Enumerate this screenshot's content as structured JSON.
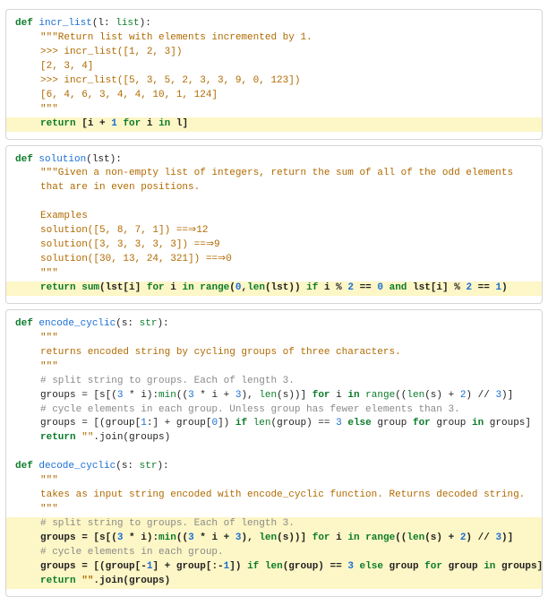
{
  "panels": [
    {
      "lines": [
        {
          "hl": false,
          "indent": 0,
          "tokens": [
            {
              "t": "def ",
              "c": "kw"
            },
            {
              "t": "incr_list",
              "c": "fn"
            },
            {
              "t": "(l: ",
              "c": "plain"
            },
            {
              "t": "list",
              "c": "ty"
            },
            {
              "t": "):",
              "c": "plain"
            }
          ]
        },
        {
          "hl": false,
          "indent": 1,
          "tokens": [
            {
              "t": "\"\"\"Return list with elements incremented by 1.",
              "c": "str"
            }
          ]
        },
        {
          "hl": false,
          "indent": 1,
          "tokens": [
            {
              "t": ">>> incr_list([1, 2, 3])",
              "c": "str"
            }
          ]
        },
        {
          "hl": false,
          "indent": 1,
          "tokens": [
            {
              "t": "[2, 3, 4]",
              "c": "str"
            }
          ]
        },
        {
          "hl": false,
          "indent": 1,
          "tokens": [
            {
              "t": ">>> incr_list([5, 3, 5, 2, 3, 3, 9, 0, 123])",
              "c": "str"
            }
          ]
        },
        {
          "hl": false,
          "indent": 1,
          "tokens": [
            {
              "t": "[6, 4, 6, 3, 4, 4, 10, 1, 124]",
              "c": "str"
            }
          ]
        },
        {
          "hl": false,
          "indent": 1,
          "tokens": [
            {
              "t": "\"\"\"",
              "c": "str"
            }
          ]
        },
        {
          "hl": true,
          "indent": 1,
          "tokens": [
            {
              "t": "return ",
              "c": "kw bold"
            },
            {
              "t": "[i + ",
              "c": "plain bold"
            },
            {
              "t": "1",
              "c": "num bold"
            },
            {
              "t": " ",
              "c": "plain"
            },
            {
              "t": "for",
              "c": "kw bold"
            },
            {
              "t": " i ",
              "c": "plain bold"
            },
            {
              "t": "in",
              "c": "kw bold"
            },
            {
              "t": " l]",
              "c": "plain bold"
            }
          ]
        }
      ]
    },
    {
      "lines": [
        {
          "hl": false,
          "indent": 0,
          "tokens": [
            {
              "t": "def ",
              "c": "kw"
            },
            {
              "t": "solution",
              "c": "fn"
            },
            {
              "t": "(lst):",
              "c": "plain"
            }
          ]
        },
        {
          "hl": false,
          "indent": 1,
          "tokens": [
            {
              "t": "\"\"\"Given a non-empty list of integers, return the sum of all of the odd elements",
              "c": "str"
            }
          ]
        },
        {
          "hl": false,
          "indent": 1,
          "tokens": [
            {
              "t": "that are in even positions.",
              "c": "str"
            }
          ]
        },
        {
          "hl": false,
          "indent": 1,
          "tokens": [
            {
              "t": "",
              "c": "plain"
            }
          ]
        },
        {
          "hl": false,
          "indent": 1,
          "tokens": [
            {
              "t": "Examples",
              "c": "str"
            }
          ]
        },
        {
          "hl": false,
          "indent": 1,
          "tokens": [
            {
              "t": "solution([5, 8, 7, 1]) ==⇒12",
              "c": "str"
            }
          ]
        },
        {
          "hl": false,
          "indent": 1,
          "tokens": [
            {
              "t": "solution([3, 3, 3, 3, 3]) ==⇒9",
              "c": "str"
            }
          ]
        },
        {
          "hl": false,
          "indent": 1,
          "tokens": [
            {
              "t": "solution([30, 13, 24, 321]) ==⇒0",
              "c": "str"
            }
          ]
        },
        {
          "hl": false,
          "indent": 1,
          "tokens": [
            {
              "t": "\"\"\"",
              "c": "str"
            }
          ]
        },
        {
          "hl": true,
          "indent": 1,
          "tokens": [
            {
              "t": "return ",
              "c": "kw bold"
            },
            {
              "t": "sum",
              "c": "bi bold"
            },
            {
              "t": "(lst[i] ",
              "c": "plain bold"
            },
            {
              "t": "for",
              "c": "kw bold"
            },
            {
              "t": " i ",
              "c": "plain bold"
            },
            {
              "t": "in ",
              "c": "kw bold"
            },
            {
              "t": "range",
              "c": "bi bold"
            },
            {
              "t": "(",
              "c": "plain bold"
            },
            {
              "t": "0",
              "c": "num bold"
            },
            {
              "t": ",",
              "c": "plain bold"
            },
            {
              "t": "len",
              "c": "bi bold"
            },
            {
              "t": "(lst)) ",
              "c": "plain bold"
            },
            {
              "t": "if",
              "c": "kw bold"
            },
            {
              "t": " i % ",
              "c": "plain bold"
            },
            {
              "t": "2",
              "c": "num bold"
            },
            {
              "t": " == ",
              "c": "plain bold"
            },
            {
              "t": "0",
              "c": "num bold"
            },
            {
              "t": " ",
              "c": "plain"
            },
            {
              "t": "and",
              "c": "kw bold"
            },
            {
              "t": " lst[i] % ",
              "c": "plain bold"
            },
            {
              "t": "2",
              "c": "num bold"
            },
            {
              "t": " == ",
              "c": "plain bold"
            },
            {
              "t": "1",
              "c": "num bold"
            },
            {
              "t": ")",
              "c": "plain bold"
            }
          ]
        }
      ]
    },
    {
      "lines": [
        {
          "hl": false,
          "indent": 0,
          "tokens": [
            {
              "t": "def ",
              "c": "kw"
            },
            {
              "t": "encode_cyclic",
              "c": "fn"
            },
            {
              "t": "(s: ",
              "c": "plain"
            },
            {
              "t": "str",
              "c": "ty"
            },
            {
              "t": "):",
              "c": "plain"
            }
          ]
        },
        {
          "hl": false,
          "indent": 1,
          "tokens": [
            {
              "t": "\"\"\"",
              "c": "str"
            }
          ]
        },
        {
          "hl": false,
          "indent": 1,
          "tokens": [
            {
              "t": "returns encoded string by cycling groups of three characters.",
              "c": "str"
            }
          ]
        },
        {
          "hl": false,
          "indent": 1,
          "tokens": [
            {
              "t": "\"\"\"",
              "c": "str"
            }
          ]
        },
        {
          "hl": false,
          "indent": 1,
          "tokens": [
            {
              "t": "# split string to groups. Each of length 3.",
              "c": "cmt"
            }
          ]
        },
        {
          "hl": false,
          "indent": 1,
          "tokens": [
            {
              "t": "groups = [s[(",
              "c": "plain"
            },
            {
              "t": "3",
              "c": "num"
            },
            {
              "t": " * i):",
              "c": "plain"
            },
            {
              "t": "min",
              "c": "bi"
            },
            {
              "t": "((",
              "c": "plain"
            },
            {
              "t": "3",
              "c": "num"
            },
            {
              "t": " * i + ",
              "c": "plain"
            },
            {
              "t": "3",
              "c": "num"
            },
            {
              "t": "), ",
              "c": "plain"
            },
            {
              "t": "len",
              "c": "bi"
            },
            {
              "t": "(s))] ",
              "c": "plain"
            },
            {
              "t": "for",
              "c": "kw"
            },
            {
              "t": " i ",
              "c": "plain"
            },
            {
              "t": "in ",
              "c": "kw"
            },
            {
              "t": "range",
              "c": "bi"
            },
            {
              "t": "((",
              "c": "plain"
            },
            {
              "t": "len",
              "c": "bi"
            },
            {
              "t": "(s) + ",
              "c": "plain"
            },
            {
              "t": "2",
              "c": "num"
            },
            {
              "t": ") // ",
              "c": "plain"
            },
            {
              "t": "3",
              "c": "num"
            },
            {
              "t": ")]",
              "c": "plain"
            }
          ]
        },
        {
          "hl": false,
          "indent": 1,
          "tokens": [
            {
              "t": "# cycle elements in each group. Unless group has fewer elements than 3.",
              "c": "cmt"
            }
          ]
        },
        {
          "hl": false,
          "indent": 1,
          "tokens": [
            {
              "t": "groups = [(group[",
              "c": "plain"
            },
            {
              "t": "1",
              "c": "num"
            },
            {
              "t": ":] + group[",
              "c": "plain"
            },
            {
              "t": "0",
              "c": "num"
            },
            {
              "t": "]) ",
              "c": "plain"
            },
            {
              "t": "if ",
              "c": "kw"
            },
            {
              "t": "len",
              "c": "bi"
            },
            {
              "t": "(group) == ",
              "c": "plain"
            },
            {
              "t": "3",
              "c": "num"
            },
            {
              "t": " ",
              "c": "plain"
            },
            {
              "t": "else",
              "c": "kw"
            },
            {
              "t": " group ",
              "c": "plain"
            },
            {
              "t": "for",
              "c": "kw"
            },
            {
              "t": " group ",
              "c": "plain"
            },
            {
              "t": "in",
              "c": "kw"
            },
            {
              "t": " groups]",
              "c": "plain"
            }
          ]
        },
        {
          "hl": false,
          "indent": 1,
          "tokens": [
            {
              "t": "return ",
              "c": "kw"
            },
            {
              "t": "\"\"",
              "c": "str"
            },
            {
              "t": ".join(groups)",
              "c": "plain"
            }
          ]
        },
        {
          "hl": false,
          "indent": 0,
          "tokens": [
            {
              "t": "",
              "c": "plain"
            }
          ]
        },
        {
          "hl": false,
          "indent": 0,
          "tokens": [
            {
              "t": "def ",
              "c": "kw"
            },
            {
              "t": "decode_cyclic",
              "c": "fn"
            },
            {
              "t": "(s: ",
              "c": "plain"
            },
            {
              "t": "str",
              "c": "ty"
            },
            {
              "t": "):",
              "c": "plain"
            }
          ]
        },
        {
          "hl": false,
          "indent": 1,
          "tokens": [
            {
              "t": "\"\"\"",
              "c": "str"
            }
          ]
        },
        {
          "hl": false,
          "indent": 1,
          "tokens": [
            {
              "t": "takes as input string encoded with encode_cyclic function. Returns decoded string.",
              "c": "str"
            }
          ]
        },
        {
          "hl": false,
          "indent": 1,
          "tokens": [
            {
              "t": "\"\"\"",
              "c": "str"
            }
          ]
        },
        {
          "hl": true,
          "indent": 1,
          "tokens": [
            {
              "t": "# split string to groups. Each of length 3.",
              "c": "cmt"
            }
          ]
        },
        {
          "hl": true,
          "indent": 1,
          "tokens": [
            {
              "t": "groups = [s[(",
              "c": "plain bold"
            },
            {
              "t": "3",
              "c": "num bold"
            },
            {
              "t": " * i):",
              "c": "plain bold"
            },
            {
              "t": "min",
              "c": "bi bold"
            },
            {
              "t": "((",
              "c": "plain bold"
            },
            {
              "t": "3",
              "c": "num bold"
            },
            {
              "t": " * i + ",
              "c": "plain bold"
            },
            {
              "t": "3",
              "c": "num bold"
            },
            {
              "t": "), ",
              "c": "plain bold"
            },
            {
              "t": "len",
              "c": "bi bold"
            },
            {
              "t": "(s))] ",
              "c": "plain bold"
            },
            {
              "t": "for",
              "c": "kw bold"
            },
            {
              "t": " i ",
              "c": "plain bold"
            },
            {
              "t": "in ",
              "c": "kw bold"
            },
            {
              "t": "range",
              "c": "bi bold"
            },
            {
              "t": "((",
              "c": "plain bold"
            },
            {
              "t": "len",
              "c": "bi bold"
            },
            {
              "t": "(s) + ",
              "c": "plain bold"
            },
            {
              "t": "2",
              "c": "num bold"
            },
            {
              "t": ") // ",
              "c": "plain bold"
            },
            {
              "t": "3",
              "c": "num bold"
            },
            {
              "t": ")]",
              "c": "plain bold"
            }
          ]
        },
        {
          "hl": true,
          "indent": 1,
          "tokens": [
            {
              "t": "# cycle elements in each group.",
              "c": "cmt"
            }
          ]
        },
        {
          "hl": true,
          "indent": 1,
          "tokens": [
            {
              "t": "groups = [(group[-",
              "c": "plain bold"
            },
            {
              "t": "1",
              "c": "num bold"
            },
            {
              "t": "] + group[:-",
              "c": "plain bold"
            },
            {
              "t": "1",
              "c": "num bold"
            },
            {
              "t": "]) ",
              "c": "plain bold"
            },
            {
              "t": "if ",
              "c": "kw bold"
            },
            {
              "t": "len",
              "c": "bi bold"
            },
            {
              "t": "(group) == ",
              "c": "plain bold"
            },
            {
              "t": "3",
              "c": "num bold"
            },
            {
              "t": " ",
              "c": "plain"
            },
            {
              "t": "else",
              "c": "kw bold"
            },
            {
              "t": " group ",
              "c": "plain bold"
            },
            {
              "t": "for",
              "c": "kw bold"
            },
            {
              "t": " group ",
              "c": "plain bold"
            },
            {
              "t": "in",
              "c": "kw bold"
            },
            {
              "t": " groups]",
              "c": "plain bold"
            }
          ]
        },
        {
          "hl": true,
          "indent": 1,
          "tokens": [
            {
              "t": "return ",
              "c": "kw bold"
            },
            {
              "t": "\"\"",
              "c": "str bold"
            },
            {
              "t": ".join(groups)",
              "c": "plain bold"
            }
          ]
        }
      ]
    }
  ]
}
